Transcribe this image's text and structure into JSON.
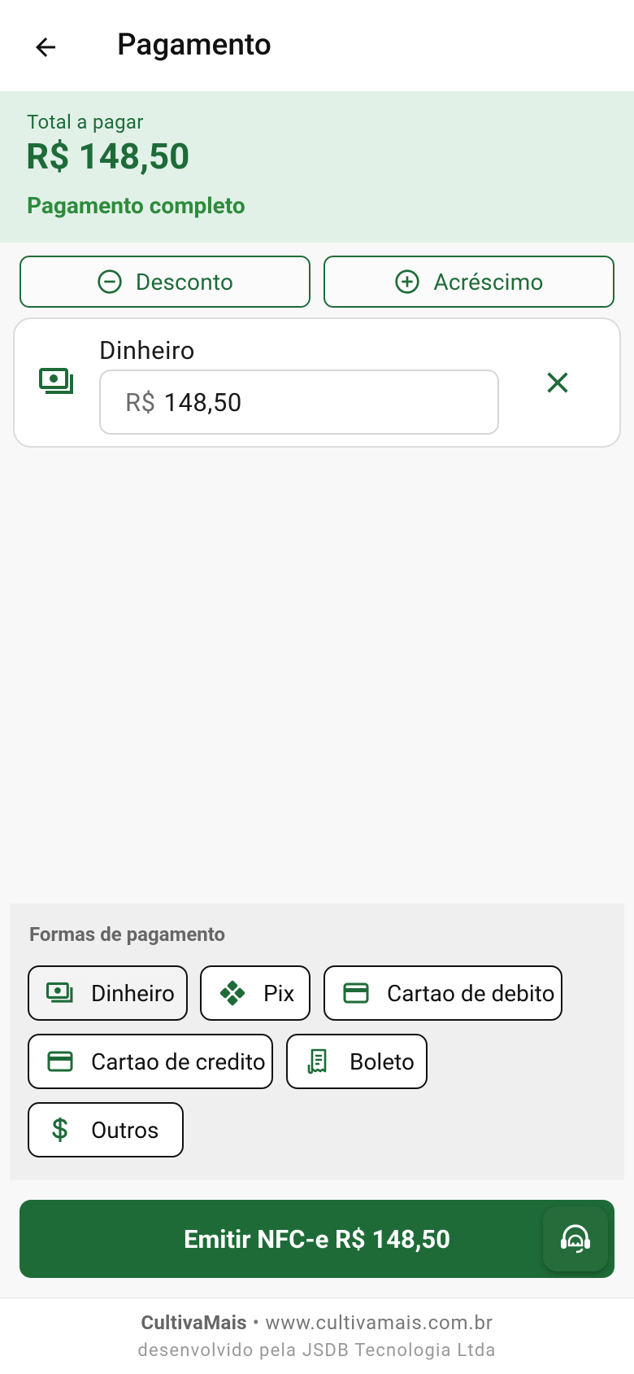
{
  "appbar": {
    "title": "Pagamento",
    "back_icon": "arrow-left-icon"
  },
  "summary": {
    "label": "Total a pagar",
    "total": "R$ 148,50",
    "status": "Pagamento completo"
  },
  "adjustments": {
    "discount_label": "Desconto",
    "surcharge_label": "Acréscimo"
  },
  "payment_entry": {
    "method": "Dinheiro",
    "currency_prefix": "R$",
    "amount": "148,50"
  },
  "methods": {
    "title": "Formas de pagamento",
    "items": [
      {
        "label": "Dinheiro",
        "icon": "cash-icon",
        "selected": true
      },
      {
        "label": "Pix",
        "icon": "pix-icon",
        "selected": false
      },
      {
        "label": "Cartao de debito",
        "icon": "credit-card-icon",
        "selected": false
      },
      {
        "label": "Cartao de credito",
        "icon": "credit-card-icon",
        "selected": false
      },
      {
        "label": "Boleto",
        "icon": "receipt-icon",
        "selected": false
      },
      {
        "label": "Outros",
        "icon": "dollar-icon",
        "selected": false
      }
    ]
  },
  "action": {
    "emit_label": "Emitir NFC-e R$ 148,50"
  },
  "footer": {
    "brand": "CultivaMais",
    "separator": "•",
    "url": "www.cultivamais.com.br",
    "credit": "desenvolvido pela JSDB Tecnologia Ltda"
  },
  "colors": {
    "primary": "#1e6b38",
    "summary_bg": "#e1f1e8",
    "status_green": "#2e8b3c"
  }
}
